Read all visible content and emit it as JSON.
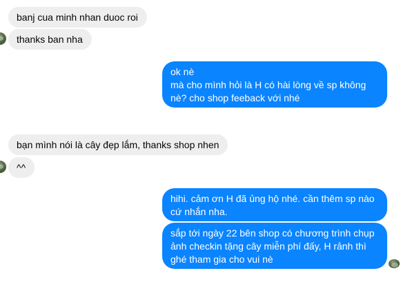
{
  "messages": {
    "m1": "banj cua minh nhan duoc roi",
    "m2": "thanks ban nha",
    "m3_l1": "ok nè",
    "m3_l2": "mà cho mình hỏi là H có hài lòng về sp không",
    "m3_l3": "nè? cho shop feeback với nhé",
    "m4": "bạn mình nói là cây đẹp lắm, thanks shop nhen",
    "m5": "^^",
    "m6_l1": "hihi. cảm ơn H đã ủng hộ nhé. cần thêm sp nào",
    "m6_l2": "cứ nhắn nha.",
    "m7_l1": "sắp tới ngày 22 bên shop có chương trình chụp",
    "m7_l2": "ảnh checkin tặng cây miễn phí đấy, H rảnh thì",
    "m7_l3": "ghé tham gia cho vui nè"
  },
  "colors": {
    "incoming_bubble": "#eeeeee",
    "outgoing_bubble": "#0a84ff"
  },
  "icons": {
    "contact_avatar": "contact-avatar-icon",
    "seen_avatar": "seen-avatar-icon"
  }
}
